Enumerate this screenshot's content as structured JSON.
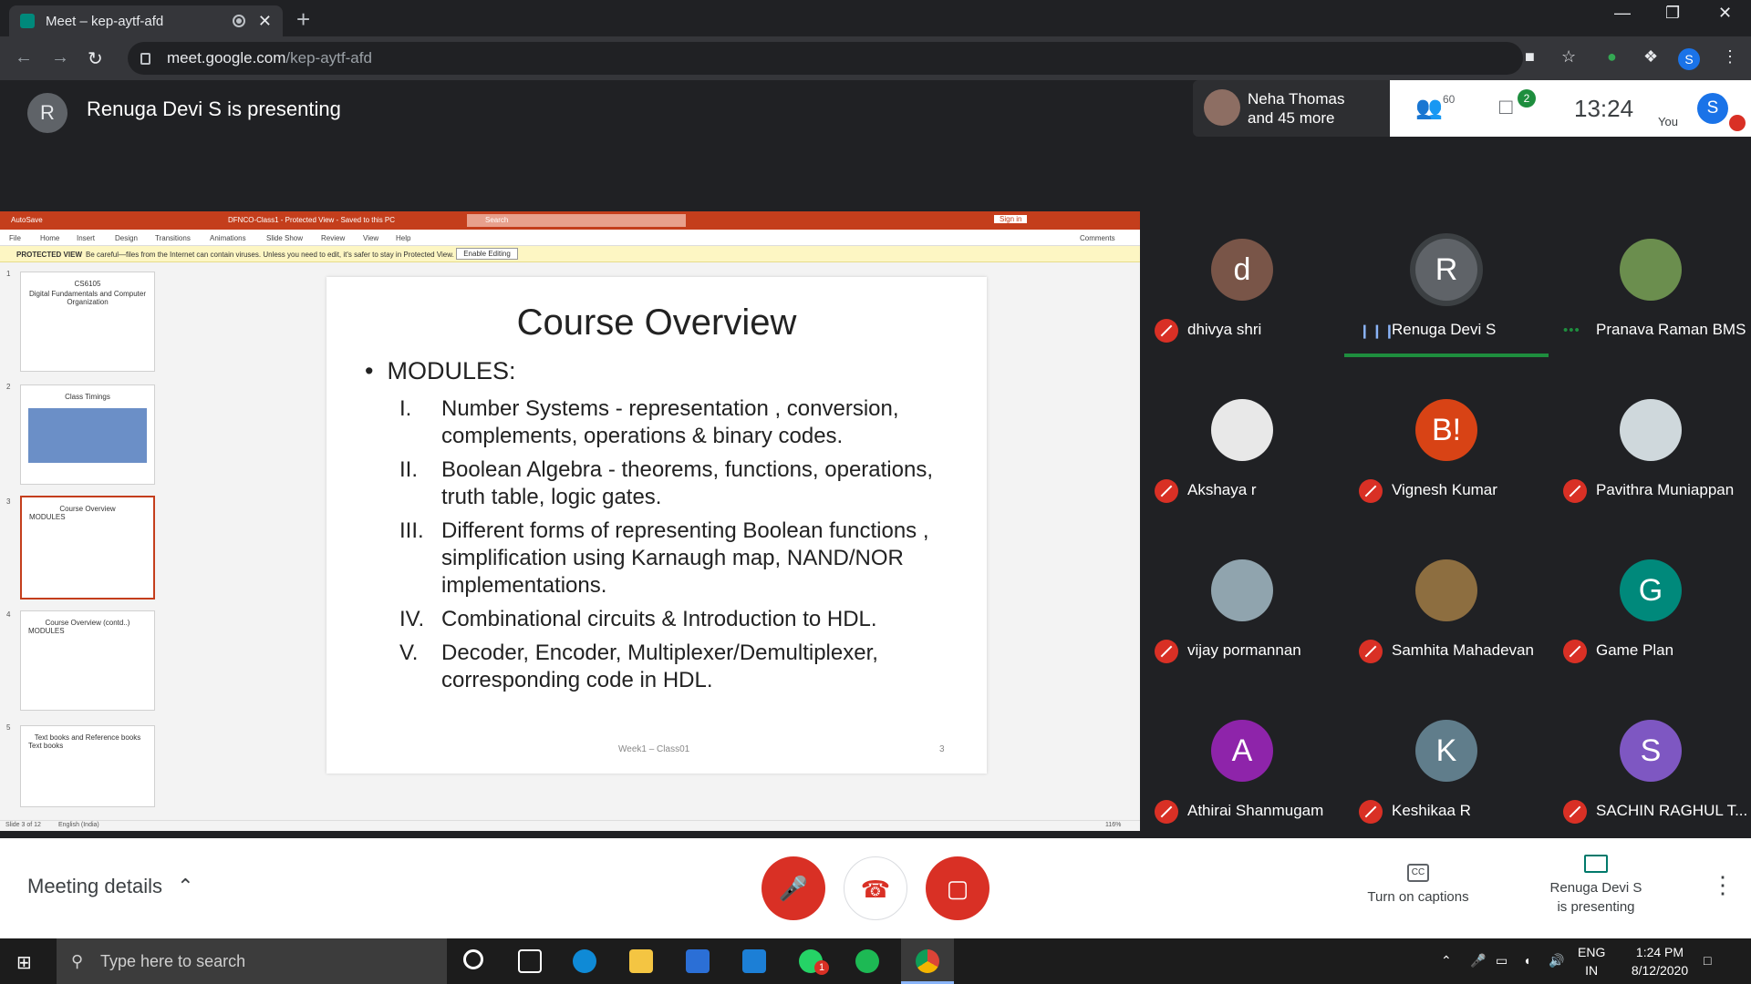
{
  "browser": {
    "tab_title": "Meet – kep-aytf-afd",
    "tab_close": "✕",
    "new_tab": "+",
    "url_host": "meet.google.com",
    "url_path": "/kep-aytf-afd",
    "profile_initial": "S"
  },
  "meet_header": {
    "presenter_initial": "R",
    "presenting_text": "Renuga Devi S is presenting",
    "people_preview": "Neha Thomas\nand 45 more",
    "participant_count": "60",
    "chat_unread": "2",
    "time": "13:24",
    "you_label": "You",
    "self_initial": "S"
  },
  "powerpoint": {
    "title_doc": "DFNCO-Class1 - Protected View - Saved to this PC",
    "autosave": "AutoSave",
    "search_placeholder": "Search",
    "sign_in": "Sign in",
    "menu": [
      "File",
      "Home",
      "Insert",
      "Design",
      "Transitions",
      "Animations",
      "Slide Show",
      "Review",
      "View",
      "Help"
    ],
    "comments": "Comments",
    "protected_label": "PROTECTED VIEW",
    "protected_msg": "Be careful—files from the Internet can contain viruses. Unless you need to edit, it's safer to stay in Protected View.",
    "enable_editing": "Enable Editing",
    "status_left": "Slide 3 of 12",
    "status_lang": "English (India)",
    "zoom": "116%",
    "thumbs": [
      {
        "num": "1",
        "title": "CS6105",
        "sub": "Digital Fundamentals and Computer Organization"
      },
      {
        "num": "2",
        "title": "Class Timings",
        "sub": ""
      },
      {
        "num": "3",
        "title": "Course Overview",
        "sub": "MODULES"
      },
      {
        "num": "4",
        "title": "Course Overview (contd..)",
        "sub": "MODULES"
      },
      {
        "num": "5",
        "title": "Text books and Reference books",
        "sub": "Text books"
      }
    ]
  },
  "slide": {
    "title": "Course Overview",
    "bullet": "MODULES:",
    "items": [
      {
        "num": "I.",
        "text": " Number Systems - representation , conversion, complements, operations & binary codes."
      },
      {
        "num": "II.",
        "text": "Boolean Algebra  - theorems, functions, operations, truth table, logic gates."
      },
      {
        "num": "III.",
        "text": "Different forms of representing Boolean functions , simplification using Karnaugh map, NAND/NOR implementations."
      },
      {
        "num": "IV.",
        "text": "Combinational circuits & Introduction to HDL."
      },
      {
        "num": "V.",
        "text": "Decoder, Encoder, Multiplexer/Demultiplexer, corresponding code in HDL."
      }
    ],
    "footer": "Week1 – Class01",
    "page": "3"
  },
  "participants": [
    {
      "name": "dhivya shri",
      "initial": "d",
      "color": "#795548",
      "state": "muted"
    },
    {
      "name": "Renuga Devi S",
      "initial": "R",
      "color": "#5f6368",
      "state": "speaking"
    },
    {
      "name": "Pranava Raman BMS",
      "initial": "",
      "color": "#6b8e4e",
      "state": "more"
    },
    {
      "name": "Akshaya r",
      "initial": "",
      "color": "#e8e8e8",
      "state": "muted"
    },
    {
      "name": "Vignesh Kumar",
      "initial": "B!",
      "color": "#d84315",
      "state": "muted"
    },
    {
      "name": "Pavithra Muniappan",
      "initial": "",
      "color": "#cfd8dc",
      "state": "muted"
    },
    {
      "name": "vijay pormannan",
      "initial": "",
      "color": "#90a4ae",
      "state": "muted"
    },
    {
      "name": "Samhita Mahadevan",
      "initial": "",
      "color": "#8d6e40",
      "state": "muted"
    },
    {
      "name": "Game Plan",
      "initial": "G",
      "color": "#00897b",
      "state": "muted"
    },
    {
      "name": "Athirai Shanmugam",
      "initial": "A",
      "color": "#8e24aa",
      "state": "muted"
    },
    {
      "name": "Keshikaa R",
      "initial": "K",
      "color": "#607d8b",
      "state": "muted"
    },
    {
      "name": "SACHIN RAGHUL T...",
      "initial": "S",
      "color": "#7e57c2",
      "state": "muted"
    }
  ],
  "bottom": {
    "meeting_details": "Meeting details",
    "captions_label": "Turn on captions",
    "presenting_label": "Renuga Devi S\nis presenting"
  },
  "taskbar": {
    "search_placeholder": "Type here to search",
    "lang": "ENG\nIN",
    "time": "1:24 PM",
    "date": "8/12/2020",
    "whatsapp_badge": "1"
  }
}
